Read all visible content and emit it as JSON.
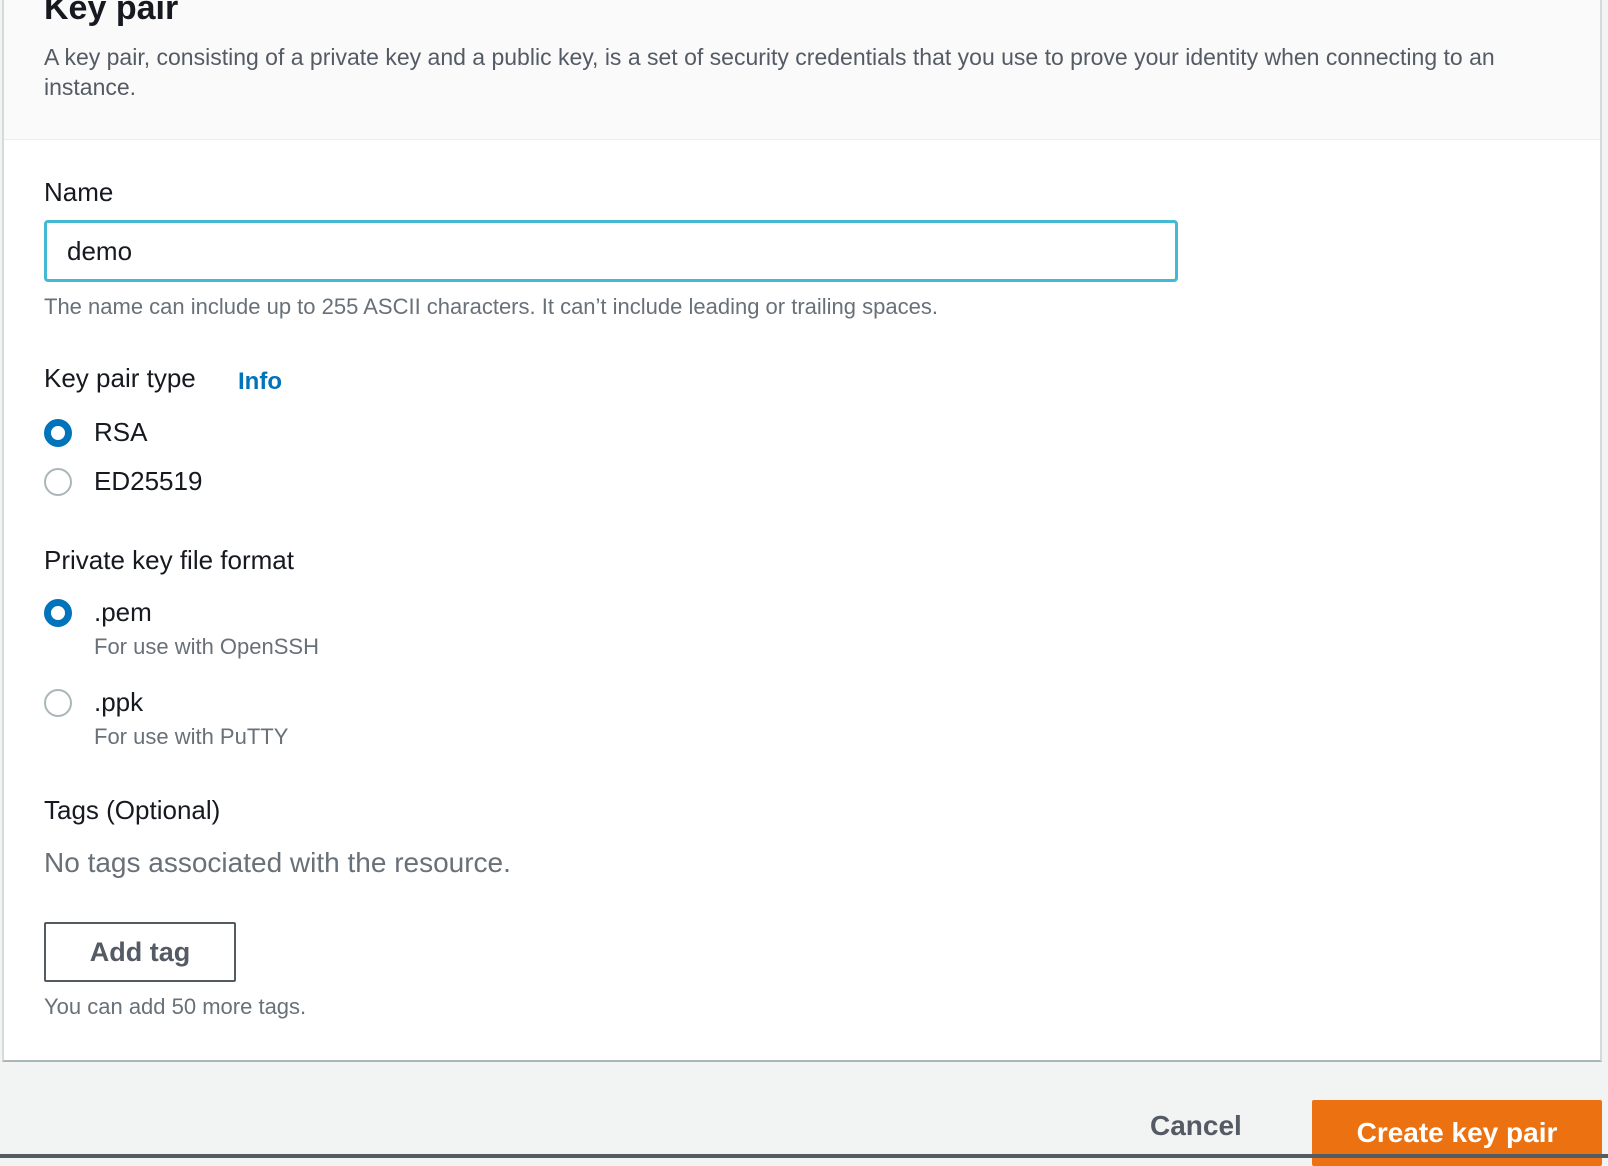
{
  "header": {
    "title": "Key pair",
    "description": "A key pair, consisting of a private key and a public key, is a set of security credentials that you use to prove your identity when connecting to an instance."
  },
  "name_field": {
    "label": "Name",
    "value": "demo",
    "hint": "The name can include up to 255 ASCII characters. It can’t include leading or trailing spaces."
  },
  "key_pair_type": {
    "label": "Key pair type",
    "info_link": "Info",
    "selected": "RSA",
    "options": [
      {
        "label": "RSA",
        "checked": true
      },
      {
        "label": "ED25519",
        "checked": false
      }
    ]
  },
  "private_key_format": {
    "label": "Private key file format",
    "selected": ".pem",
    "options": [
      {
        "label": ".pem",
        "description": "For use with OpenSSH",
        "checked": true
      },
      {
        "label": ".ppk",
        "description": "For use with PuTTY",
        "checked": false
      }
    ]
  },
  "tags": {
    "label": "Tags (Optional)",
    "empty_text": "No tags associated with the resource.",
    "add_button": "Add tag",
    "limit_hint": "You can add 50 more tags."
  },
  "footer": {
    "cancel_label": "Cancel",
    "create_label": "Create key pair"
  },
  "colors": {
    "accent_blue": "#0073bb",
    "input_focus": "#44b9d6",
    "primary_orange": "#ec7211",
    "panel_background": "#ffffff",
    "page_background": "#f2f3f3"
  }
}
